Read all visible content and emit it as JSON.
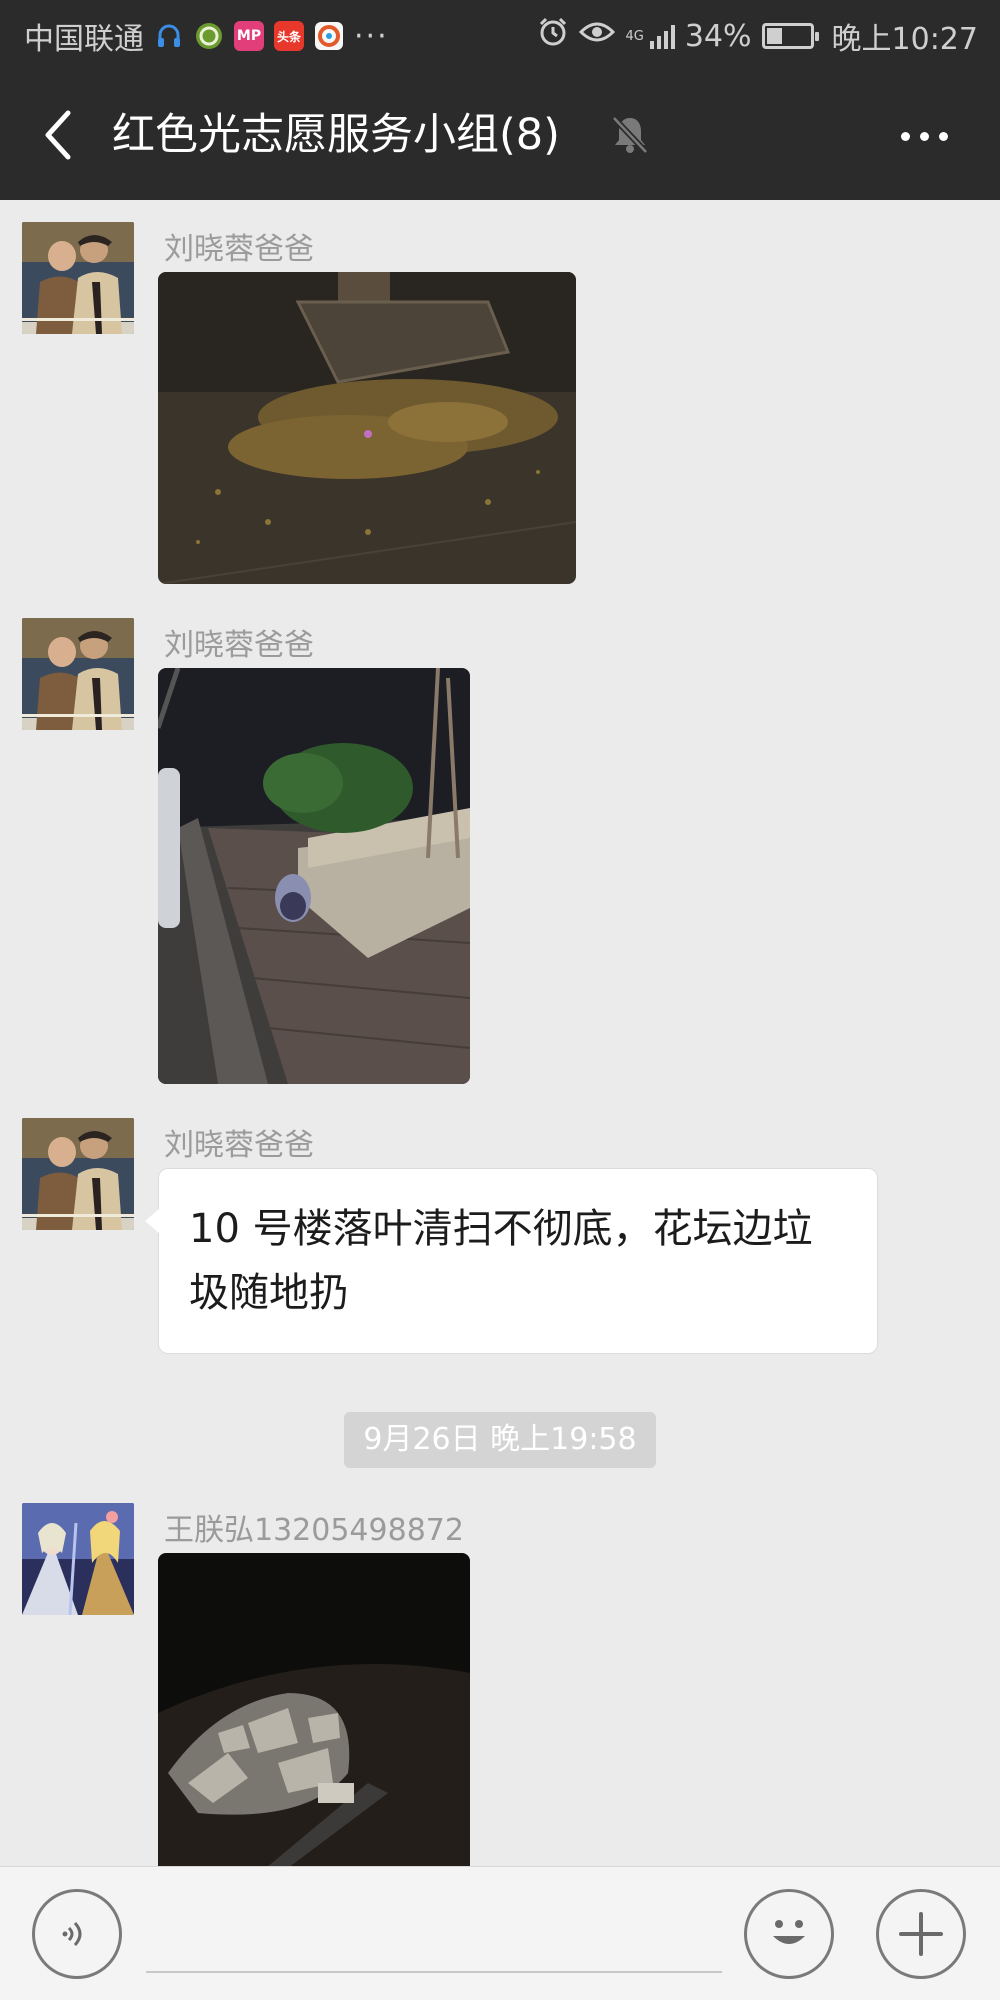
{
  "status_bar": {
    "carrier": "中国联通",
    "app_icons": [
      {
        "name": "headset-app-icon",
        "color": "#3a8ee6"
      },
      {
        "name": "china-mobile-app-icon",
        "color": "#6b9b2e"
      },
      {
        "name": "mp-app-icon",
        "label": "MP",
        "color": "#e23e7a"
      },
      {
        "name": "toutiao-app-icon",
        "label": "头条",
        "color": "#e8382c"
      },
      {
        "name": "browser-app-icon",
        "color": "#e25a2b"
      }
    ],
    "more": "···",
    "network": "4G",
    "battery": "34%",
    "battery_level": 0.34,
    "time": "晚上10:27"
  },
  "header": {
    "title": "红色光志愿服务小组(8)",
    "back_icon": "back-chevron-icon",
    "mute_icon": "bell-muted-icon",
    "more_icon": "more-dots-icon"
  },
  "messages": [
    {
      "type": "image",
      "sender": "刘晓蓉爸爸",
      "avatar": "couple-photo-avatar",
      "image": "night-fallen-leaves-under-tree"
    },
    {
      "type": "image",
      "sender": "刘晓蓉爸爸",
      "avatar": "couple-photo-avatar",
      "image": "night-flowerbed-with-trash-bag"
    },
    {
      "type": "text",
      "sender": "刘晓蓉爸爸",
      "avatar": "couple-photo-avatar",
      "text": "10 号楼落叶清扫不彻底，花坛边垃圾随地扔"
    },
    {
      "type": "timestamp",
      "text": "9月26日 晚上19:58"
    },
    {
      "type": "image",
      "sender": "王朕弘13205498872",
      "avatar": "anime-knight-avatar",
      "image": "night-rubble-pile"
    }
  ],
  "input_bar": {
    "voice_icon": "voice-icon",
    "emoji_icon": "emoji-icon",
    "plus_icon": "plus-icon"
  }
}
